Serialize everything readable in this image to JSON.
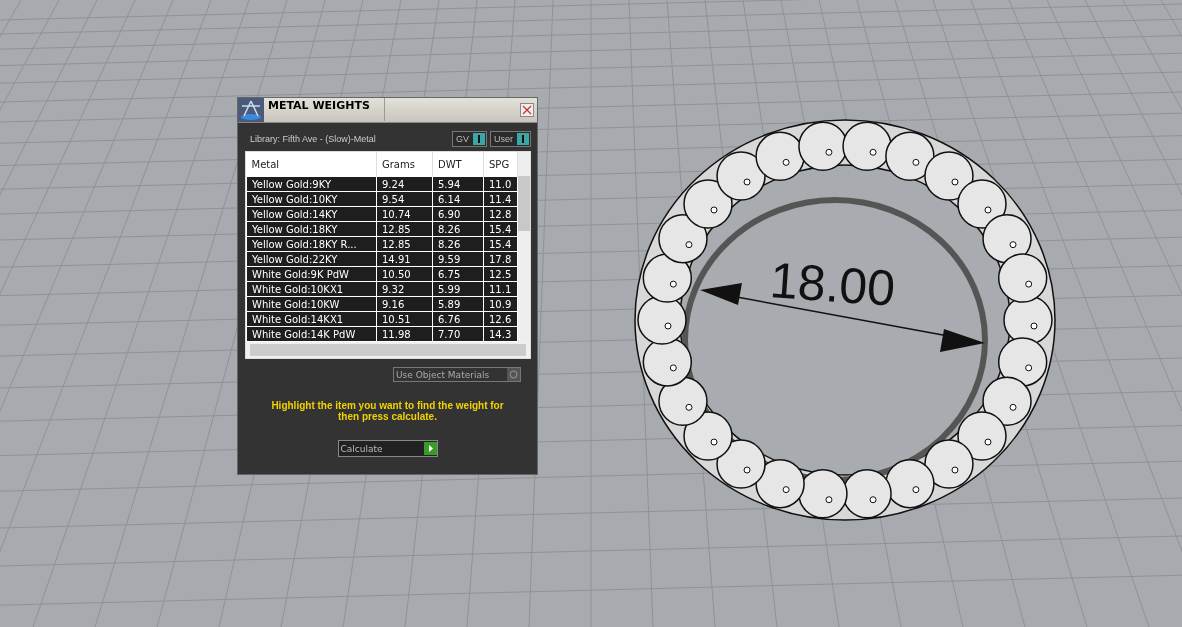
{
  "window": {
    "title": "METAL WEIGHTS"
  },
  "library": "Library: Fifth Ave - (Slow)-Metal",
  "toggles": [
    {
      "label": "GV",
      "on": true
    },
    {
      "label": "User",
      "on": true
    }
  ],
  "table": {
    "columns": [
      "Metal",
      "Grams",
      "DWT",
      "SPG"
    ],
    "rows": [
      [
        "Yellow Gold:9KY",
        "9.24",
        "5.94",
        "11.0"
      ],
      [
        "Yellow Gold:10KY",
        "9.54",
        "6.14",
        "11.4"
      ],
      [
        "Yellow Gold:14KY",
        "10.74",
        "6.90",
        "12.8"
      ],
      [
        "Yellow Gold:18KY",
        "12.85",
        "8.26",
        "15.4"
      ],
      [
        "Yellow Gold:18KY R...",
        "12.85",
        "8.26",
        "15.4"
      ],
      [
        "Yellow Gold:22KY",
        "14.91",
        "9.59",
        "17.8"
      ],
      [
        "White Gold:9K PdW",
        "10.50",
        "6.75",
        "12.5"
      ],
      [
        "White Gold:10KX1",
        "9.32",
        "5.99",
        "11.1"
      ],
      [
        "White Gold:10KW",
        "9.16",
        "5.89",
        "10.9"
      ],
      [
        "White Gold:14KX1",
        "10.51",
        "6.76",
        "12.6"
      ],
      [
        "White Gold:14K PdW",
        "11.98",
        "7.70",
        "14.3"
      ]
    ]
  },
  "use_object_materials": {
    "label": "Use Object Materials",
    "checked": false
  },
  "hint": "Highlight the item you want to find the weight for then press calculate.",
  "calculate_button": "Calculate",
  "viewport": {
    "dimension": "18.00"
  }
}
